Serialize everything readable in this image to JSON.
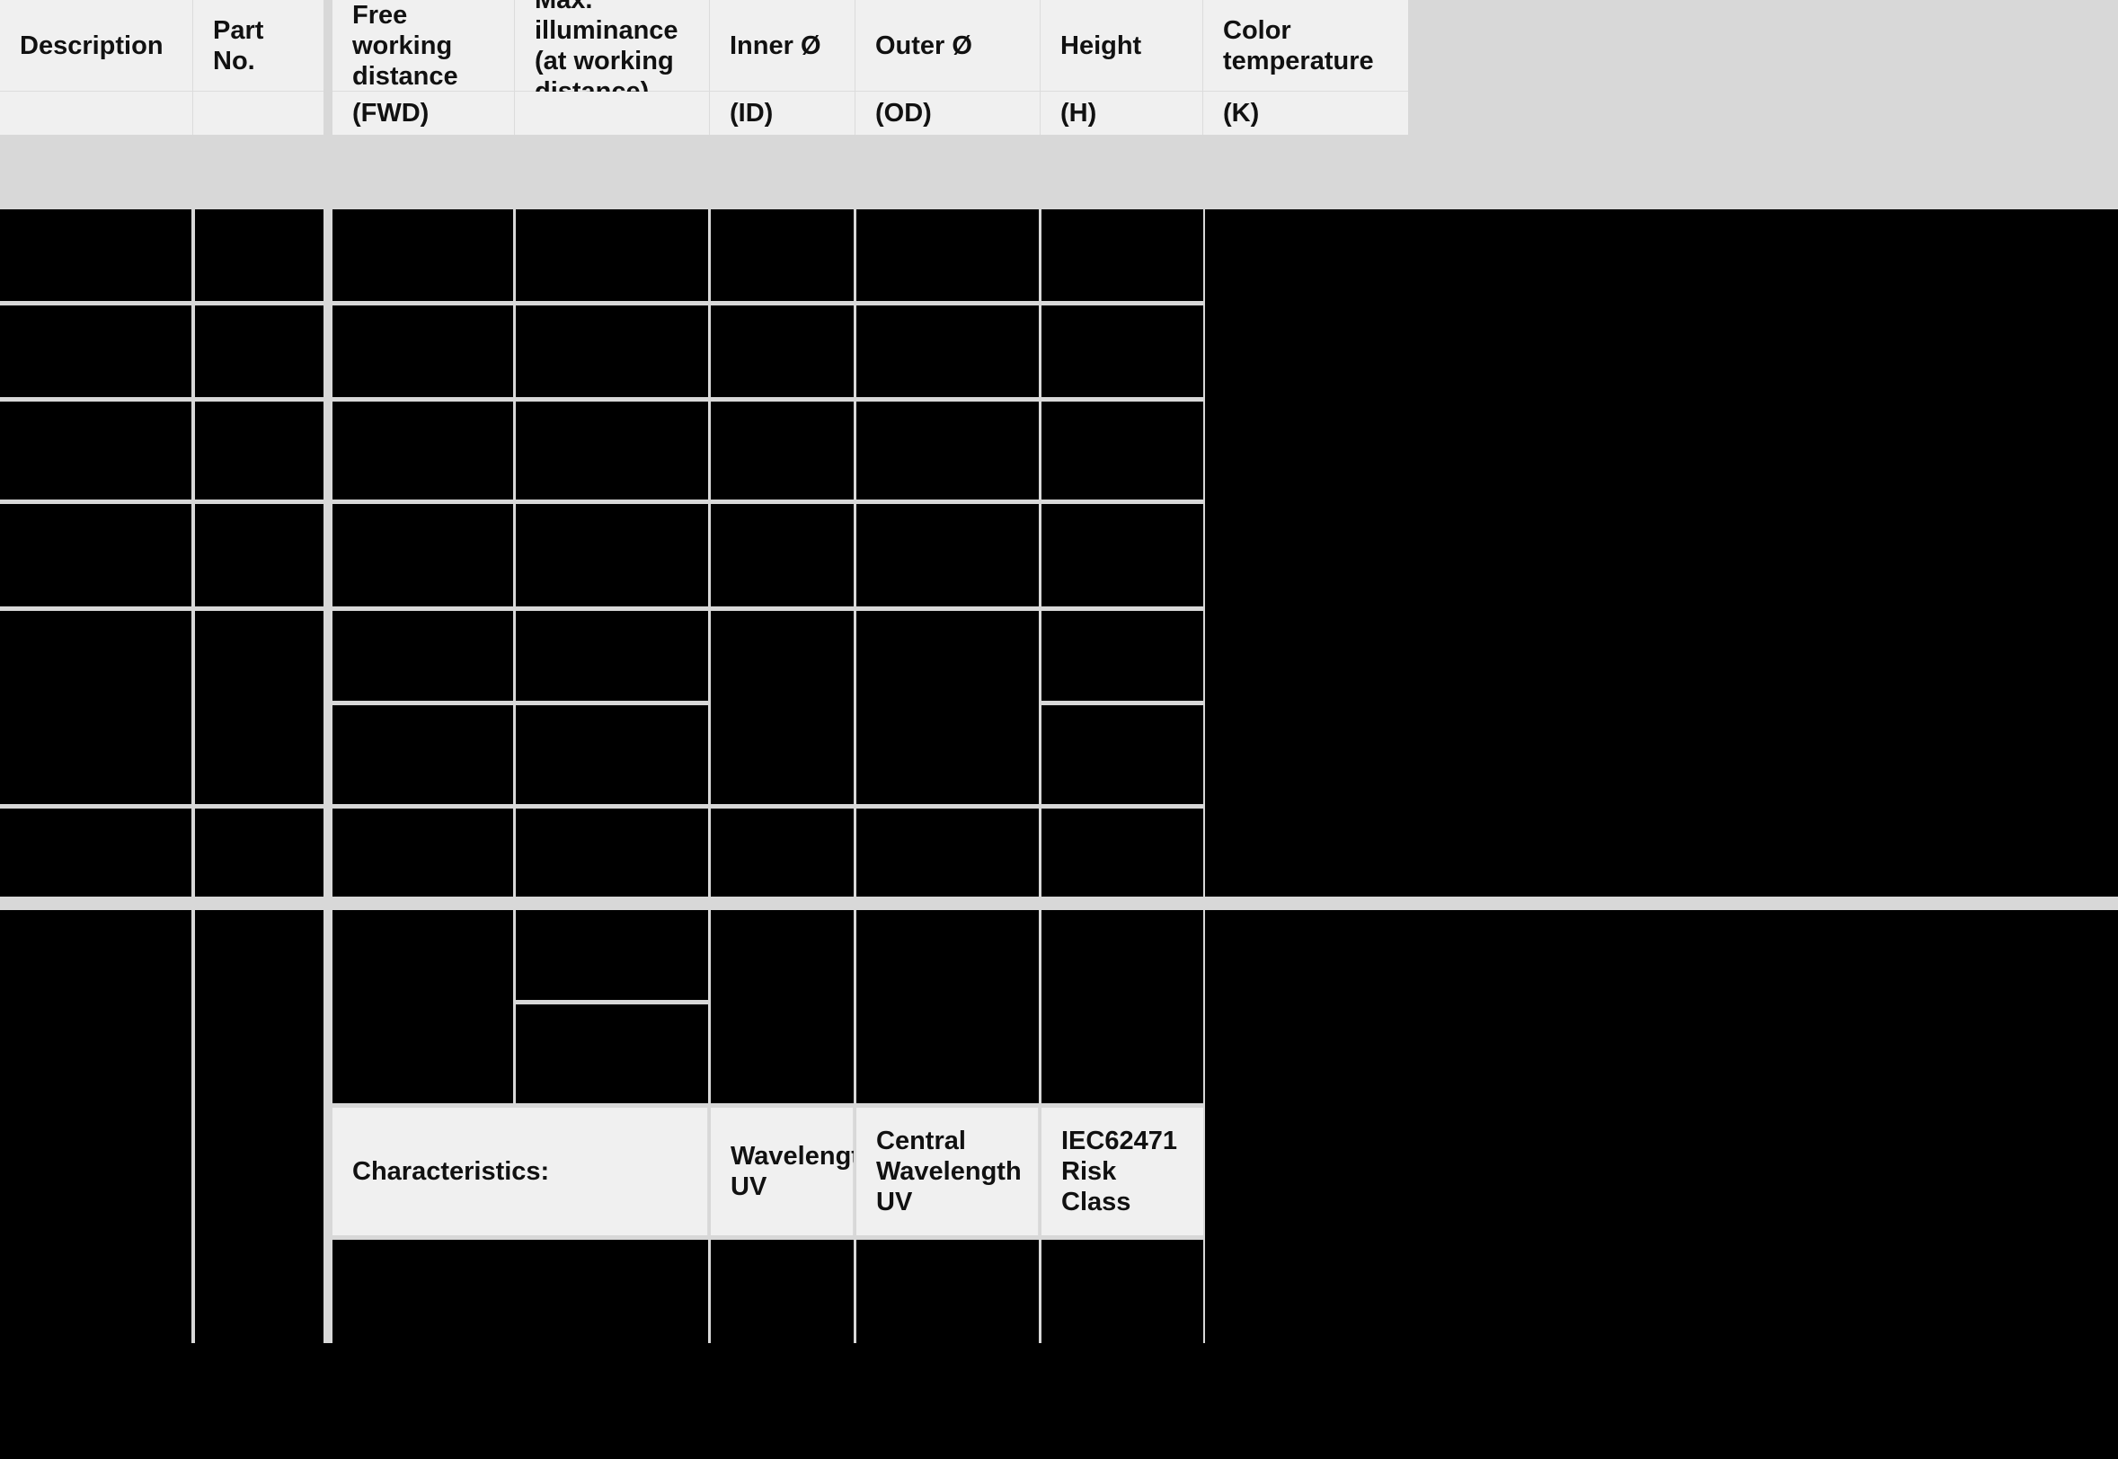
{
  "document": {
    "kind": "product-specification-table",
    "note_visible_text_only": true
  },
  "colors": {
    "header_background": "#f0f0f0",
    "gutter_background": "#d8d8d8",
    "redacted_cell": "#000000",
    "hairline": "#dcdcdc",
    "text": "#111111",
    "page_background": "#000000"
  },
  "table": {
    "columns": [
      {
        "key": "description",
        "label": "Description",
        "sub": ""
      },
      {
        "key": "part_no",
        "label": "Part No.",
        "sub": ""
      },
      {
        "key": "fwd",
        "label": "Free working\ndistance",
        "sub": "(FWD)"
      },
      {
        "key": "max_illuminance",
        "label": "Max. illuminance\n(at working\ndistance)",
        "sub": ""
      },
      {
        "key": "inner_diameter",
        "label": "Inner Ø",
        "sub": "(ID)"
      },
      {
        "key": "outer_diameter",
        "label": "Outer Ø",
        "sub": "(OD)"
      },
      {
        "key": "height",
        "label": "Height",
        "sub": "(H)"
      },
      {
        "key": "color_temperature",
        "label": "Color\ntemperature",
        "sub": "(K)"
      }
    ],
    "characteristics_row": {
      "label": "Characteristics:",
      "wavelength_uv": "Wavelength\nUV",
      "central_wavelength_uv": "Central\nWavelength UV",
      "risk_class": "IEC62471\nRisk Class"
    },
    "body_rows_redacted": true,
    "redacted_cell_text": ""
  }
}
